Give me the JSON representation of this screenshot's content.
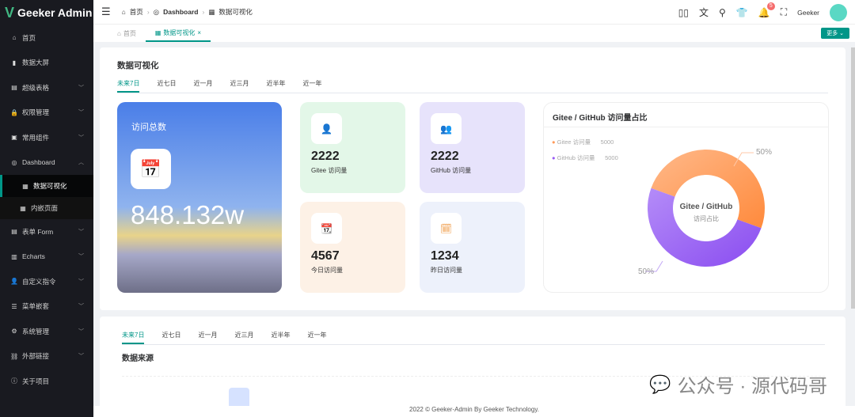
{
  "app": {
    "title": "Geeker Admin"
  },
  "sidebar": {
    "items": [
      {
        "label": "首页",
        "icon": "home-icon"
      },
      {
        "label": "数据大屏",
        "icon": "bar-chart-icon"
      },
      {
        "label": "超级表格",
        "icon": "table-icon",
        "chevron": true
      },
      {
        "label": "权限管理",
        "icon": "lock-icon",
        "chevron": true
      },
      {
        "label": "常用组件",
        "icon": "component-icon",
        "chevron": true
      },
      {
        "label": "Dashboard",
        "icon": "dashboard-icon",
        "chevron": true,
        "expanded": true
      },
      {
        "label": "数据可视化",
        "icon": "grid-icon",
        "sub": true,
        "active": true
      },
      {
        "label": "内嵌页面",
        "icon": "grid-icon",
        "sub": true
      },
      {
        "label": "表单 Form",
        "icon": "form-icon",
        "chevron": true
      },
      {
        "label": "Echarts",
        "icon": "chart-icon",
        "chevron": true
      },
      {
        "label": "自定义指令",
        "icon": "user-icon",
        "chevron": true
      },
      {
        "label": "菜单嵌套",
        "icon": "menu-icon",
        "chevron": true
      },
      {
        "label": "系统管理",
        "icon": "gear-icon",
        "chevron": true
      },
      {
        "label": "外部链接",
        "icon": "link-icon",
        "chevron": true
      },
      {
        "label": "关于项目",
        "icon": "info-icon"
      }
    ]
  },
  "header": {
    "breadcrumb": [
      "首页",
      "Dashboard",
      "数据可视化"
    ],
    "username": "Geeker",
    "notifications": "5"
  },
  "tabs": {
    "items": [
      "首页",
      "数据可视化"
    ],
    "more": "更多"
  },
  "main": {
    "title": "数据可视化",
    "ranges": [
      "未来7日",
      "近七日",
      "近一月",
      "近三月",
      "近半年",
      "近一年"
    ],
    "total": {
      "label": "访问总数",
      "value": "848.132w"
    },
    "stats": [
      {
        "value": "2222",
        "label": "Gitee 访问量"
      },
      {
        "value": "2222",
        "label": "GitHub 访问量"
      },
      {
        "value": "4567",
        "label": "今日访问量"
      },
      {
        "value": "1234",
        "label": "昨日访问量"
      }
    ],
    "pie": {
      "title": "Gitee / GitHub 访问量占比",
      "center_title": "Gitee / GitHub",
      "center_sub": "访问占比",
      "legend": [
        {
          "name": "Gitee 访问量",
          "value": "5000",
          "color": "#ff9a5a"
        },
        {
          "name": "GitHub 访问量",
          "value": "5000",
          "color": "#9a5cf5"
        }
      ],
      "labels": [
        "50%",
        "50%"
      ]
    }
  },
  "source": {
    "title": "数据来源"
  },
  "footer": "2022 © Geeker-Admin By Geeker Technology.",
  "watermark": "公众号 · 源代码哥"
}
